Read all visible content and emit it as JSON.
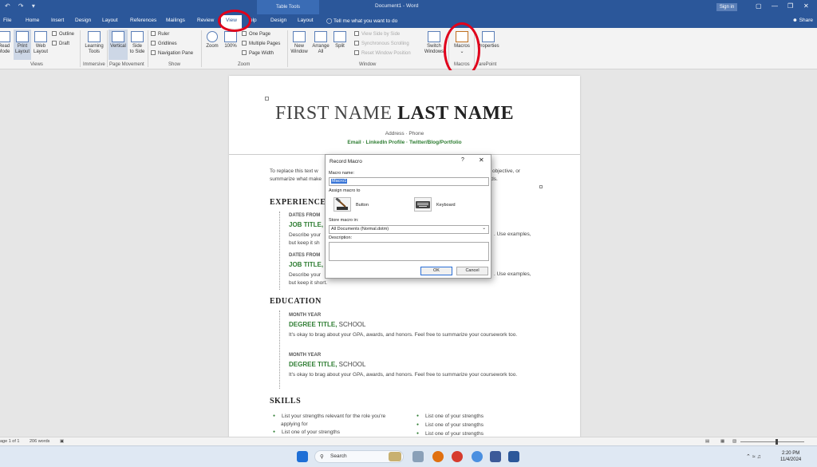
{
  "titlebar": {
    "qat": "↶ ↷ ▾",
    "context_tab": "Table Tools",
    "document_title": "Document1 - Word",
    "signin": "Sign in"
  },
  "tabs": {
    "file": "File",
    "home": "Home",
    "insert": "Insert",
    "design": "Design",
    "layout": "Layout",
    "references": "References",
    "mailings": "Mailings",
    "review": "Review",
    "view": "View",
    "help": "elp",
    "table_design": "Design",
    "table_layout": "Layout",
    "tell_me": "Tell me what you want to do",
    "share": "Share"
  },
  "ribbon": {
    "read_mode": "Read\nMode",
    "print_layout": "Print\nLayout",
    "web_layout": "Web\nLayout",
    "outline": "Outline",
    "draft": "Draft",
    "group_views": "Views",
    "learning_tools": "Learning\nTools",
    "group_immersive": "Immersive",
    "vertical": "Vertical",
    "side_to_side": "Side\nto Side",
    "group_page_movement": "Page Movement",
    "ruler": "Ruler",
    "gridlines": "Gridlines",
    "navigation_pane": "Navigation Pane",
    "group_show": "Show",
    "zoom": "Zoom",
    "zoom_100": "100%",
    "one_page": "One Page",
    "multiple_pages": "Multiple Pages",
    "page_width": "Page Width",
    "group_zoom": "Zoom",
    "new_window": "New\nWindow",
    "arrange_all": "Arrange\nAll",
    "split": "Split",
    "view_side_by_side": "View Side by Side",
    "synchronous_scrolling": "Synchronous Scrolling",
    "reset_window_position": "Reset Window Position",
    "switch_windows": "Switch\nWindows",
    "group_window": "Window",
    "macros": "Macros",
    "group_macros": "Macros",
    "properties": "Properties",
    "group_sharepoint": "arePoint"
  },
  "document": {
    "name_first": "FIRST NAME ",
    "name_last": "LAST NAME",
    "address": "Address · Phone",
    "links": "Email · LinkedIn Profile · Twitter/Blog/Portfolio",
    "intro_1": "To replace this text w",
    "intro_1r": "r objective, or",
    "intro_2": "summarize what make",
    "intro_2r": "rds.",
    "experience": "EXPERIENCE",
    "dates_from_1": "DATES FROM",
    "job_title_1": "JOB TITLE, C",
    "desc_1a": "Describe your",
    "desc_1a_r": ". Use examples,",
    "desc_1b": "but keep it sh",
    "dates_from_2": "DATES FROM",
    "job_title_2": "JOB TITLE, C",
    "desc_2a": "Describe your",
    "desc_2a_r": ". Use examples,",
    "desc_2b": "but keep it short.",
    "education": "EDUCATION",
    "month_year_1": "MONTH YEAR",
    "degree_1": "DEGREE TITLE,",
    "school_1": " SCHOOL",
    "edu_desc_1": "It's okay to brag about your GPA, awards, and honors. Feel free to summarize your coursework too.",
    "month_year_2": "MONTH YEAR",
    "degree_2": "DEGREE TITLE,",
    "school_2": " SCHOOL",
    "edu_desc_2": "It's okay to brag about your GPA, awards, and honors. Feel free to summarize your coursework too.",
    "skills": "SKILLS",
    "skill_l1": "List your strengths relevant for the role you're",
    "skill_l1b": "applying for",
    "skill_l2": "List one of your strengths",
    "skill_r1": "List one of your strengths",
    "skill_r2": "List one of your strengths",
    "skill_r3": "List one of your strengths"
  },
  "dialog": {
    "title": "Record Macro",
    "help": "?",
    "close": "✕",
    "macro_name_label": "Macro name:",
    "macro_name_value": "Macro1",
    "assign_label": "Assign macro to",
    "button_label": "Button",
    "keyboard_label": "Keyboard",
    "store_label": "Store macro in:",
    "store_value": "All Documents (Normal.dotm)",
    "description_label": "Description:",
    "ok": "OK",
    "cancel": "Cancel"
  },
  "status": {
    "page": "age 1 of 1",
    "words": "206 words"
  },
  "taskbar": {
    "search_placeholder": "Search",
    "time": "2:20 PM",
    "date": "11/4/2024"
  },
  "colors": {
    "word_blue": "#2b579a",
    "accent_green": "#2e7d32",
    "annotation_red": "#e0001b"
  }
}
